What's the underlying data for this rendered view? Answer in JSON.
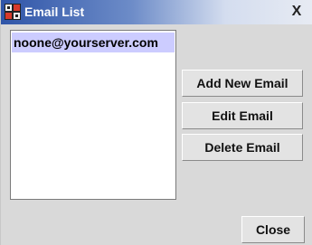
{
  "window": {
    "title": "Email List",
    "close_glyph": "X",
    "icon": "app-icon"
  },
  "email_list": {
    "items": [
      "noone@yourserver.com"
    ],
    "selected_index": 0
  },
  "buttons": {
    "add_label": "Add New Email",
    "edit_label": "Edit Email",
    "delete_label": "Delete Email",
    "close_label": "Close"
  },
  "colors": {
    "title_gradient_start": "#2f55a8",
    "title_gradient_end": "#e7ebf3",
    "selection": "#ccccff",
    "panel": "#d9d9d9"
  }
}
